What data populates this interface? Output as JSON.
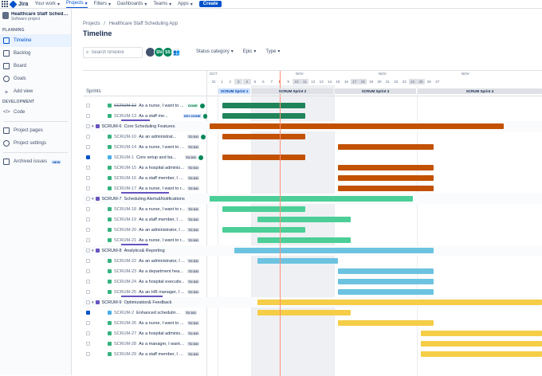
{
  "topnav": {
    "brand": "Jira",
    "items": [
      "Your work",
      "Projects",
      "Filters",
      "Dashboards",
      "Teams",
      "Apps"
    ],
    "active_item": "Projects",
    "create_label": "Create"
  },
  "sidebar": {
    "project_name": "Healthcare Staff Scheduli...",
    "project_type": "Software project",
    "planning_heading": "PLANNING",
    "planning_items": [
      {
        "label": "Timeline",
        "icon": "timeline-icon",
        "active": true
      },
      {
        "label": "Backlog",
        "icon": "backlog-icon"
      },
      {
        "label": "Board",
        "icon": "board-icon"
      },
      {
        "label": "Goals",
        "icon": "goals-icon"
      }
    ],
    "add_view_label": "Add view",
    "development_heading": "DEVELOPMENT",
    "code_label": "Code",
    "project_pages_label": "Project pages",
    "project_settings_label": "Project settings",
    "archived_issues_label": "Archived issues",
    "new_badge": "NEW"
  },
  "main": {
    "breadcrumb_projects": "Projects",
    "breadcrumb_sep": "/",
    "breadcrumb_project": "Healthcare Staff Scheduling App",
    "title": "Timeline",
    "search_placeholder": "Search timeline",
    "avatars": [
      {
        "initials": "",
        "color": "#42526e"
      },
      {
        "initials": "SN",
        "color": "#00875a"
      },
      {
        "initials": "SS",
        "color": "#00875a"
      }
    ],
    "filters": [
      "Status category",
      "Epic",
      "Type"
    ]
  },
  "timeline": {
    "months": [
      {
        "label": "OCT",
        "day_index": 0
      },
      {
        "label": "NOV",
        "day_index": 10
      },
      {
        "label": "NOV",
        "day_index": 20
      },
      {
        "label": "NOV",
        "day_index": 30
      }
    ],
    "days": [
      "31",
      "1",
      "2",
      "3",
      "4",
      "5",
      "6",
      "7",
      "8",
      "9",
      "10",
      "11",
      "12",
      "13",
      "14",
      "15",
      "16",
      "17",
      "18",
      "19",
      "20",
      "21",
      "22",
      "23",
      "24",
      "25",
      "26",
      "27"
    ],
    "weekend_indexes": [
      3,
      4,
      10,
      11,
      17,
      18,
      24,
      25
    ],
    "today_index": 8,
    "sprints_label": "Sprints",
    "sprints": [
      {
        "name": "SCRUM Sprint 1",
        "start": 1,
        "end": 5,
        "active": true
      },
      {
        "name": "SCRUM Sprint 2",
        "start": 5,
        "end": 15
      },
      {
        "name": "SCRUM Sprint 3",
        "start": 15,
        "end": 25
      },
      {
        "name": "SCRUM Sprint 4",
        "start": 25,
        "end": 41
      }
    ],
    "rows": [
      {
        "kind": "issue",
        "key": "SCRUM-12",
        "summary": "As a nurse, I want to ...",
        "status": "DONE",
        "status_kind": "done",
        "avatar": true,
        "strike": true,
        "bar": [
          1.5,
          11.5
        ],
        "color": "#1f845a"
      },
      {
        "kind": "issue",
        "key": "SCRUM-13",
        "summary": "As a staff me...",
        "status": "DEV DONE",
        "status_kind": "dev",
        "avatar": true,
        "bar": [
          1.5,
          11.5
        ],
        "color": "#1f845a"
      },
      {
        "kind": "epic",
        "key": "SCRUM-6",
        "summary": "Core Scheduling Features",
        "bar": [
          0,
          35.5
        ],
        "color": "#c25100"
      },
      {
        "kind": "issue",
        "key": "SCRUM-10",
        "summary": "As an administrat...",
        "status": "TO DO",
        "avatar": true,
        "bar": [
          1.5,
          11.5
        ],
        "color": "#c25100"
      },
      {
        "kind": "issue",
        "key": "SCRUM-14",
        "summary": "As a nurse, I want to v...",
        "status": "TO DO",
        "bar": [
          15.5,
          27
        ],
        "color": "#c25100"
      },
      {
        "kind": "issue",
        "key": "SCRUM-1",
        "summary": "Core setup and ba...",
        "status": "TO DO",
        "avatar": true,
        "task": true,
        "checked": true,
        "bar": [
          1.5,
          11.5
        ],
        "color": "#c25100"
      },
      {
        "kind": "issue",
        "key": "SCRUM-15",
        "summary": "As a hospital administ...",
        "status": "TO DO",
        "bar": [
          15.5,
          27
        ],
        "color": "#c25100"
      },
      {
        "kind": "issue",
        "key": "SCRUM-16",
        "summary": "As a staff member, I w...",
        "status": "TO DO",
        "bar": [
          15.5,
          27
        ],
        "color": "#c25100"
      },
      {
        "kind": "issue",
        "key": "SCRUM-17",
        "summary": "As a nurse, I want to r...",
        "status": "TO DO",
        "bar": [
          15.5,
          27
        ],
        "color": "#c25100"
      },
      {
        "kind": "epic",
        "key": "SCRUM-7",
        "summary": "Scheduling Alerts&Notifications",
        "bar": [
          0,
          24.5
        ],
        "color": "#4bce97"
      },
      {
        "kind": "issue",
        "key": "SCRUM-18",
        "summary": "As a nurse, I want to r...",
        "status": "TO DO",
        "bar": [
          1.5,
          11.5
        ],
        "color": "#4bce97"
      },
      {
        "kind": "issue",
        "key": "SCRUM-19",
        "summary": "As a staff member, I w...",
        "status": "TO DO",
        "bar": [
          5.8,
          17
        ],
        "color": "#4bce97"
      },
      {
        "kind": "issue",
        "key": "SCRUM-20",
        "summary": "As an administrator, I ...",
        "status": "TO DO",
        "bar": [
          1.5,
          11.5
        ],
        "color": "#4bce97"
      },
      {
        "kind": "issue",
        "key": "SCRUM-21",
        "summary": "As a nurse, I want to r...",
        "status": "TO DO",
        "bar": [
          5.8,
          17
        ],
        "color": "#4bce97"
      },
      {
        "kind": "epic",
        "key": "SCRUM-8",
        "summary": "Analytics& Reporting",
        "bar": [
          3,
          27
        ],
        "color": "#6cc3e0"
      },
      {
        "kind": "issue",
        "key": "SCRUM-22",
        "summary": "As an administrator, I ...",
        "status": "TO DO",
        "bar": [
          5.8,
          15.5
        ],
        "color": "#6cc3e0"
      },
      {
        "kind": "issue",
        "key": "SCRUM-23",
        "summary": "As a department hea...",
        "status": "TO DO",
        "bar": [
          15.5,
          27
        ],
        "color": "#6cc3e0"
      },
      {
        "kind": "issue",
        "key": "SCRUM-24",
        "summary": "As a hospital executiv...",
        "status": "TO DO",
        "bar": [
          15.5,
          27
        ],
        "color": "#6cc3e0"
      },
      {
        "kind": "issue",
        "key": "SCRUM-25",
        "summary": "As an HR manager, I ...",
        "status": "TO DO",
        "bar": [
          15.5,
          27
        ],
        "color": "#6cc3e0"
      },
      {
        "kind": "epic",
        "key": "SCRUM-9",
        "summary": "Optimization& Feedback",
        "bar": [
          5.8,
          42
        ],
        "color": "#f5cd47"
      },
      {
        "kind": "issue",
        "key": "SCRUM-2",
        "summary": "Enhanced scheduling a...",
        "status": "TO DO",
        "task": true,
        "checked": true,
        "bar": [
          5.8,
          17
        ],
        "color": "#f5cd47"
      },
      {
        "kind": "issue",
        "key": "SCRUM-26",
        "summary": "As a nurse, I want to ...",
        "status": "TO DO",
        "bar": [
          15.5,
          27
        ],
        "color": "#f5cd47"
      },
      {
        "kind": "issue",
        "key": "SCRUM-27",
        "summary": "As a hospital administ...",
        "status": "TO DO",
        "bar": [
          25.5,
          42
        ],
        "color": "#f5cd47"
      },
      {
        "kind": "issue",
        "key": "SCRUM-28",
        "summary": "As a manager, I want t...",
        "status": "TO DO",
        "bar": [
          25.5,
          42
        ],
        "color": "#f5cd47"
      },
      {
        "kind": "issue",
        "key": "SCRUM-29",
        "summary": "As a staff member, I w...",
        "status": "TO DO",
        "bar": [
          25.5,
          42
        ],
        "color": "#f5cd47"
      }
    ]
  }
}
